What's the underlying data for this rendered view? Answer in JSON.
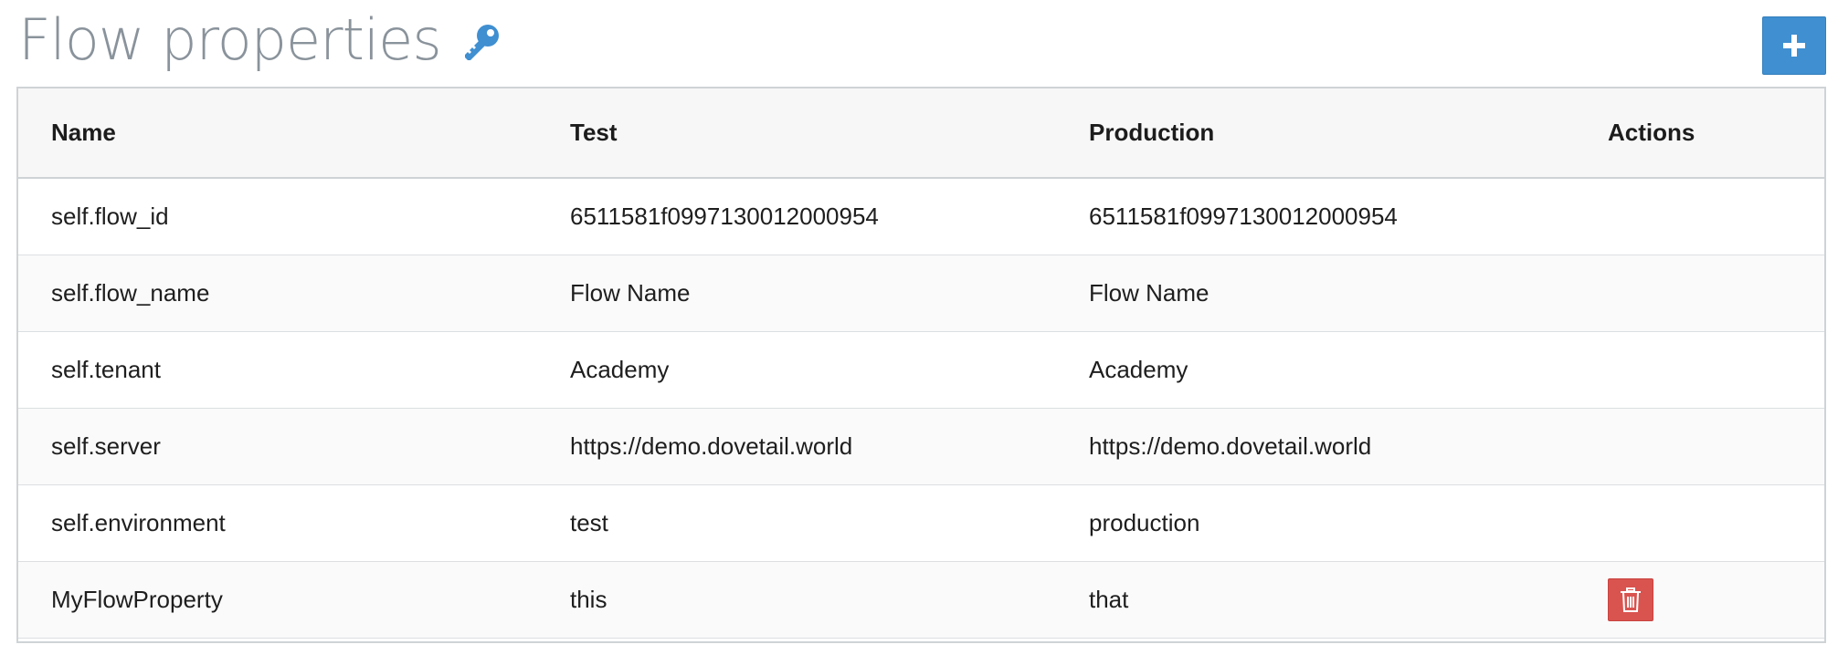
{
  "header": {
    "title": "Flow properties",
    "title_icon": "key-icon",
    "add_button_icon": "plus-icon"
  },
  "colors": {
    "title": "#8a939b",
    "key_icon": "#3f8fd1",
    "add_button": "#3f8fd1",
    "delete_button": "#d9534f"
  },
  "table": {
    "columns": [
      "Name",
      "Test",
      "Production",
      "Actions"
    ],
    "rows": [
      {
        "name": "self.flow_id",
        "test": "6511581f0997130012000954",
        "production": "6511581f0997130012000954",
        "deletable": false
      },
      {
        "name": "self.flow_name",
        "test": "Flow Name",
        "production": "Flow Name",
        "deletable": false
      },
      {
        "name": "self.tenant",
        "test": "Academy",
        "production": "Academy",
        "deletable": false
      },
      {
        "name": "self.server",
        "test": "https://demo.dovetail.world",
        "production": "https://demo.dovetail.world",
        "deletable": false
      },
      {
        "name": "self.environment",
        "test": "test",
        "production": "production",
        "deletable": false
      },
      {
        "name": "MyFlowProperty",
        "test": "this",
        "production": "that",
        "deletable": true,
        "delete_icon": "trash-icon"
      }
    ]
  }
}
